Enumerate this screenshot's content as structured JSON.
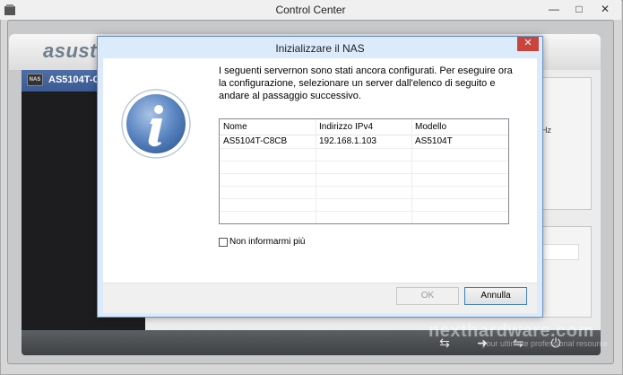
{
  "window": {
    "title": "Control Center"
  },
  "brand": {
    "logo_text": "asust"
  },
  "sidebar": {
    "device_label": "AS5104T-C",
    "device_badge": "NAS"
  },
  "content": {
    "partial_text": "Hz"
  },
  "dialog": {
    "title": "Inizializzare il NAS",
    "message": "I seguenti servernon sono stati ancora configurati. Per eseguire ora la configurazione, selezionare un server dall'elenco di seguito e andare al passaggio successivo.",
    "table": {
      "headers": [
        "Nome",
        "Indirizzo IPv4",
        "Modello"
      ],
      "rows": [
        [
          "AS5104T-C8CB",
          "192.168.1.103",
          "AS5104T"
        ]
      ]
    },
    "checkbox_label": "Non informarmi più",
    "ok_label": "OK",
    "cancel_label": "Annulla"
  },
  "watermark": {
    "text": "nexthardware.com",
    "subtext": "your ultimate professional resource"
  },
  "colors": {
    "accent": "#3a5a94",
    "dialog_frame": "#6a8fc0",
    "close": "#c9443b"
  }
}
